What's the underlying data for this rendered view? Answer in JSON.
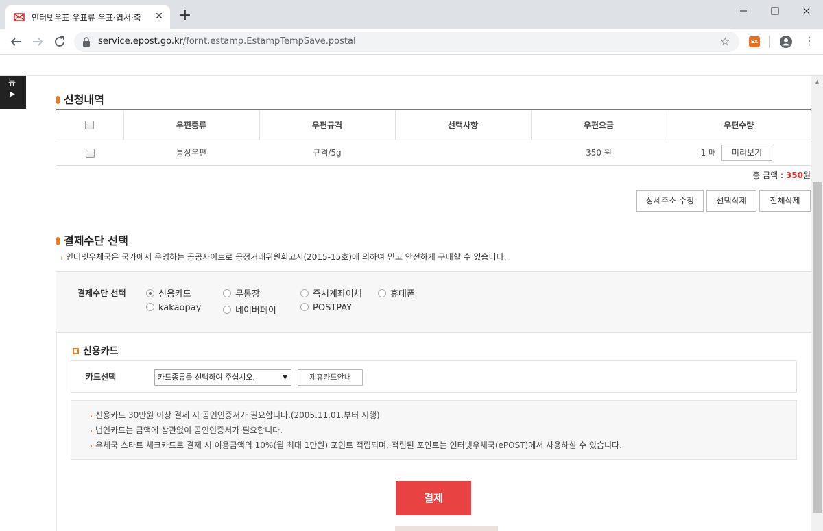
{
  "browser": {
    "tab_title": "인터넷우표-우표류-우표·엽서·축",
    "tab_close": "✕",
    "new_tab": "+",
    "url_host": "service.epost.go.kr",
    "url_path": "/fornt.estamp.EstampTempSave.postal",
    "ext_label": "EX"
  },
  "quick_menu": {
    "label": "뉴"
  },
  "order": {
    "title": "신청내역",
    "columns": [
      "우편종류",
      "우편규격",
      "선택사항",
      "우편요금",
      "우편수량"
    ],
    "rows": [
      {
        "type": "통상우편",
        "size": "규격/5g",
        "option": "",
        "fee": "350 원",
        "qty": "1 매",
        "preview_label": "미리보기"
      }
    ],
    "total_label": "총 금액 : ",
    "total_amount": "350",
    "total_unit": "원",
    "buttons": {
      "edit_address": "상세주소 수정",
      "delete_selected": "선택삭제",
      "delete_all": "전체삭제"
    }
  },
  "payment": {
    "title": "결제수단 선택",
    "notice": "인터넷우체국은 국가에서 운영하는 공공사이트로 공정거래위원회고시(2015-15호)에 의하여 믿고 안전하게 구매할 수 있습니다.",
    "label": "결제수단 선택",
    "methods": [
      "신용카드",
      "무통장",
      "즉시계좌이체",
      "휴대폰",
      "kakaopay",
      "네이버페이",
      "POSTPAY"
    ],
    "selected": "신용카드"
  },
  "credit_card": {
    "title": "신용카드",
    "card_label": "카드선택",
    "select_value": "카드종류를 선택하여 주십시오.",
    "partner_button": "제휴카드안내",
    "info": [
      "신용카드 30만원 이상 결제 시 공인인증서가 필요합니다.(2005.11.01.부터 시행)",
      "법인카드는 금액에 상관없이 공인인증서가 필요합니다.",
      "우체국 스타트 체크카드로 결제 시 이용금액의 10%(월 최대 1만원) 포인트 적립되며, 적립된 포인트는 인터넷우체국(ePOST)에서 사용하실 수 있습니다."
    ]
  },
  "submit": {
    "label": "결제"
  },
  "colors": {
    "accent": "#f07a1a",
    "pay_button": "#e94242",
    "total_amount": "#e03030"
  }
}
